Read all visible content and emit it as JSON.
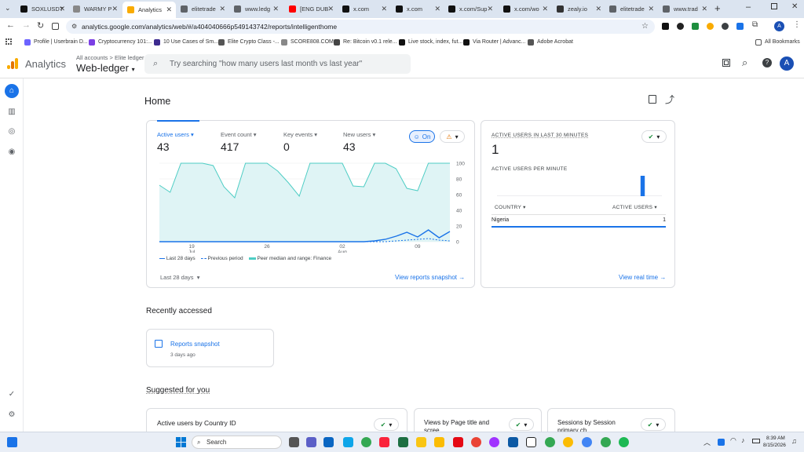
{
  "browser": {
    "tabs": [
      {
        "title": "SOXLUSDT",
        "color": "#111111"
      },
      {
        "title": "WARMY P",
        "color": "#888888"
      },
      {
        "title": "Analytics",
        "color": "#f9ab00"
      },
      {
        "title": "elitetrade",
        "color": "#5f6368"
      },
      {
        "title": "www.ledg",
        "color": "#5f6368"
      },
      {
        "title": "[ENG DUB",
        "color": "#ff0000"
      },
      {
        "title": "x.com",
        "color": "#111111"
      },
      {
        "title": "x.com",
        "color": "#111111"
      },
      {
        "title": "x.com/Sup",
        "color": "#111111"
      },
      {
        "title": "x.com/wo",
        "color": "#111111"
      },
      {
        "title": "zealy.io",
        "color": "#333333"
      },
      {
        "title": "elitetrade",
        "color": "#5f6368"
      },
      {
        "title": "www.trad",
        "color": "#5f6368"
      }
    ],
    "url": "analytics.google.com/analytics/web/#/a404040666p549143742/reports/intelligenthome",
    "bookmarks": [
      {
        "label": "Profile | Userbrain D...",
        "color": "#6c63ff"
      },
      {
        "label": "Cryptocurrency 101:...",
        "color": "#7b3fe4"
      },
      {
        "label": "10 Use Cases of Sm...",
        "color": "#3d2b8f"
      },
      {
        "label": "Elite Crypto Class -...",
        "color": "#555555"
      },
      {
        "label": "SCORE808.COM",
        "color": "#888888"
      },
      {
        "label": "Re: Bitcoin v0.1 rele...",
        "color": "#444444"
      },
      {
        "label": "Live stock, index, fut...",
        "color": "#111111"
      },
      {
        "label": "Via Router | Advanc...",
        "color": "#111111"
      },
      {
        "label": "Adobe Acrobat",
        "color": "#555555"
      }
    ],
    "all_bookmarks": "All Bookmarks",
    "profile_initial": "A"
  },
  "header": {
    "app_name": "Analytics",
    "breadcrumb": "All accounts > Elite ledger",
    "property": "Web-ledger",
    "search_placeholder": "Try searching \"how many users last month vs last year\"",
    "avatar": "A"
  },
  "page": {
    "title": "Home"
  },
  "overview": {
    "metrics": [
      {
        "label": "Active users",
        "value": "43"
      },
      {
        "label": "Event count",
        "value": "417"
      },
      {
        "label": "Key events",
        "value": "0"
      },
      {
        "label": "New users",
        "value": "43"
      }
    ],
    "toggle": "On",
    "legend": [
      "Last 28 days",
      "Previous period",
      "Peer median and range: Finance"
    ],
    "date_range": "Last 28 days",
    "link": "View reports snapshot"
  },
  "chart_data": {
    "type": "line",
    "x_ticks": [
      "19",
      "26",
      "02",
      "09"
    ],
    "x_month_labels": [
      "Jul",
      "",
      "Aug",
      ""
    ],
    "y_ticks": [
      "0",
      "20",
      "40",
      "60",
      "80",
      "100"
    ],
    "ylim": [
      0,
      100
    ],
    "series": [
      {
        "name": "Last 28 days",
        "values": [
          0,
          0,
          0,
          0,
          0,
          0,
          0,
          0,
          0,
          0,
          0,
          0,
          0,
          0,
          0,
          0,
          0,
          0,
          0,
          0,
          1,
          3,
          7,
          12,
          6,
          15,
          5,
          13
        ]
      },
      {
        "name": "Previous period",
        "values": [
          0,
          0,
          0,
          0,
          0,
          0,
          0,
          0,
          0,
          0,
          0,
          0,
          0,
          0,
          0,
          0,
          0,
          0,
          0,
          0,
          0,
          0,
          1,
          2,
          3,
          4,
          2,
          1
        ]
      },
      {
        "name": "Peer median and range: Finance",
        "values": [
          72,
          63,
          104,
          106,
          103,
          97,
          70,
          56,
          104,
          108,
          104,
          90,
          75,
          58,
          104,
          106,
          104,
          102,
          71,
          70,
          104,
          106,
          93,
          68,
          65,
          104,
          101,
          100
        ]
      }
    ]
  },
  "realtime": {
    "title": "ACTIVE USERS IN LAST 30 MINUTES",
    "value": "1",
    "subtitle": "ACTIVE USERS PER MINUTE",
    "per_minute": [
      0,
      0,
      0,
      0,
      0,
      0,
      0,
      0,
      0,
      0,
      0,
      0,
      0,
      0,
      0,
      0,
      0,
      0,
      0,
      0,
      0,
      0,
      0,
      0,
      0,
      0,
      1,
      0,
      0,
      0
    ],
    "col_country": "COUNTRY",
    "col_users": "ACTIVE USERS",
    "rows": [
      {
        "country": "Nigeria",
        "users": "1"
      }
    ],
    "link": "View real time"
  },
  "recent": {
    "heading": "Recently accessed",
    "item_title": "Reports snapshot",
    "item_time": "3 days ago"
  },
  "suggested": {
    "heading": "Suggested for you",
    "cards": [
      "Active users by Country ID",
      "Views by Page title and scree...",
      "Sessions by Session primary ch..."
    ]
  },
  "taskbar": {
    "search": "Search",
    "time": "8:39 AM",
    "date": "8/15/2026"
  }
}
